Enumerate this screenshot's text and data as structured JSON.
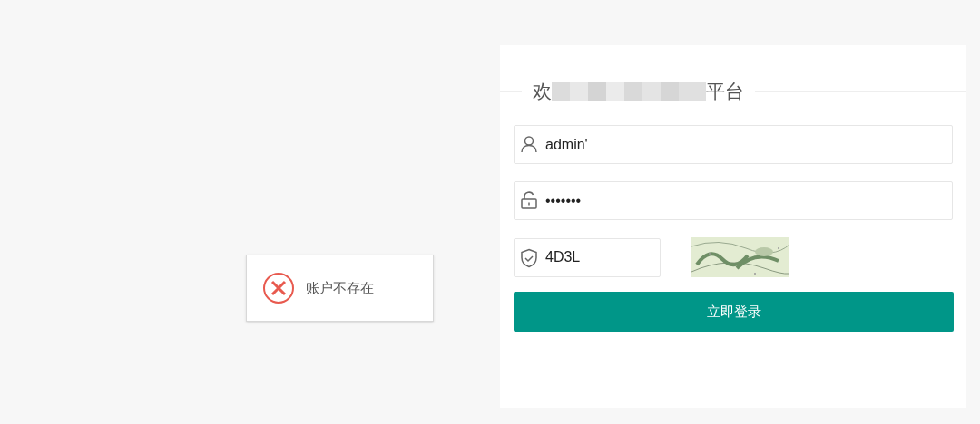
{
  "login_panel": {
    "title_start": "欢",
    "title_end": "平台",
    "fields": [
      {
        "kind": "user",
        "value": "admin'"
      },
      {
        "kind": "password",
        "value": "•••••••"
      },
      {
        "kind": "captcha",
        "value": "4D3L"
      }
    ],
    "submit_button": "立即登录"
  },
  "toast": {
    "kind": "error",
    "message": "账户不存在"
  }
}
